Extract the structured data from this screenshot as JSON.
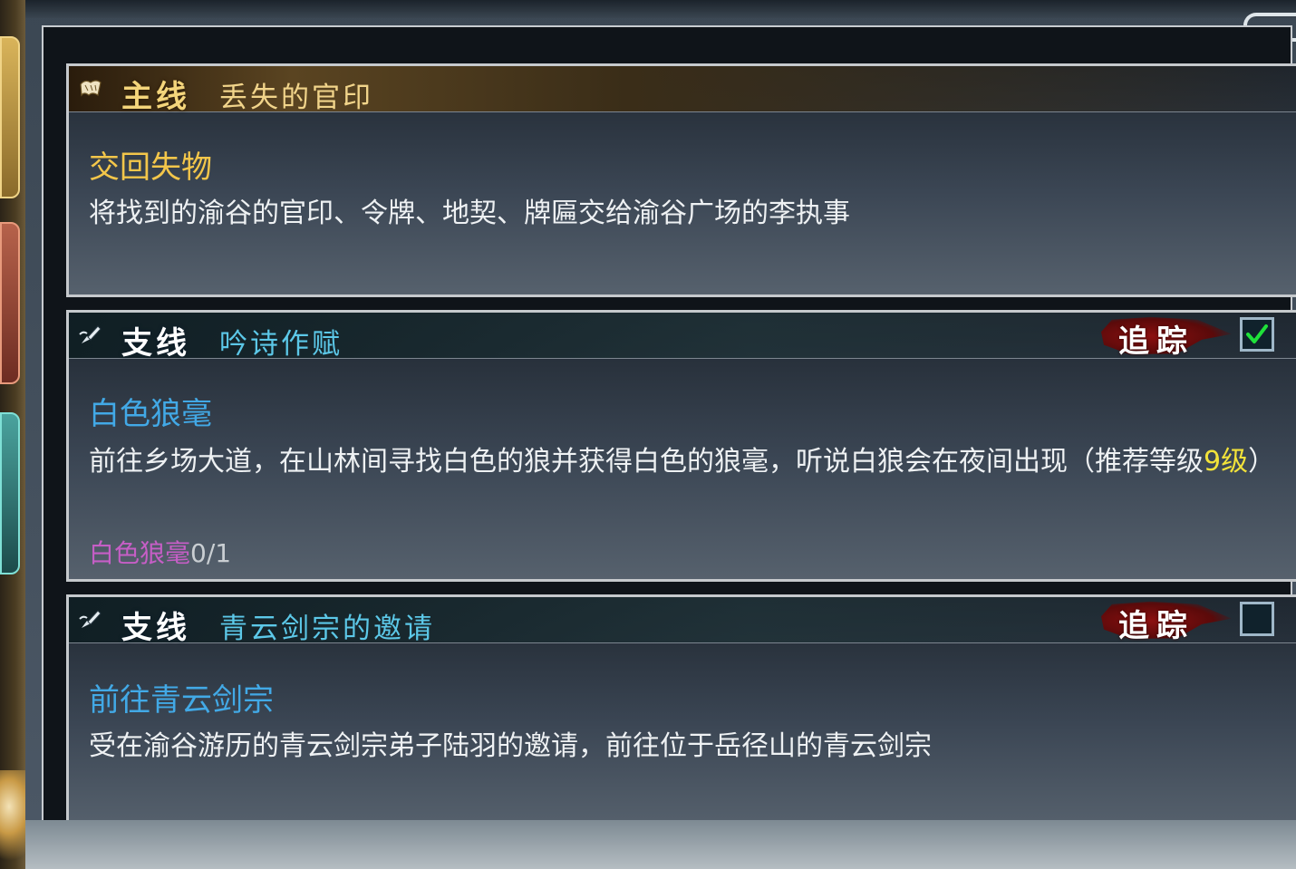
{
  "quests": [
    {
      "type_label": "主线",
      "name": "丢失的官印",
      "objective": "交回失物",
      "description": "将找到的渝谷的官印、令牌、地契、牌匾交给渝谷广场的李执事",
      "icon": "scroll-icon"
    },
    {
      "type_label": "支线",
      "name": "吟诗作赋",
      "track_label": "追踪",
      "tracked": true,
      "objective": "白色狼毫",
      "description_main": "前往乡场大道，在山林间寻找白色的狼并获得白色的狼毫，听说白狼会在夜间出现（推荐等级",
      "recommended_level": "9级",
      "description_end": "）",
      "progress_item": "白色狼毫",
      "progress_count": "0/1",
      "icon": "brush-icon"
    },
    {
      "type_label": "支线",
      "name": "青云剑宗的邀请",
      "track_label": "追踪",
      "tracked": false,
      "objective": "前往青云剑宗",
      "description": "受在渝谷游历的青云剑宗弟子陆羽的邀请，前往位于岳径山的青云剑宗",
      "icon": "brush-icon"
    }
  ],
  "colors": {
    "main_quest": "#f4d57b",
    "side_quest_name": "#5cc8e8",
    "objective_blue": "#42a9e6",
    "objective_gold": "#f3c64a",
    "level_highlight": "#f2e23a",
    "progress_item": "#c65ec6",
    "check_green": "#1fe13a",
    "track_red": "#8c1010"
  }
}
